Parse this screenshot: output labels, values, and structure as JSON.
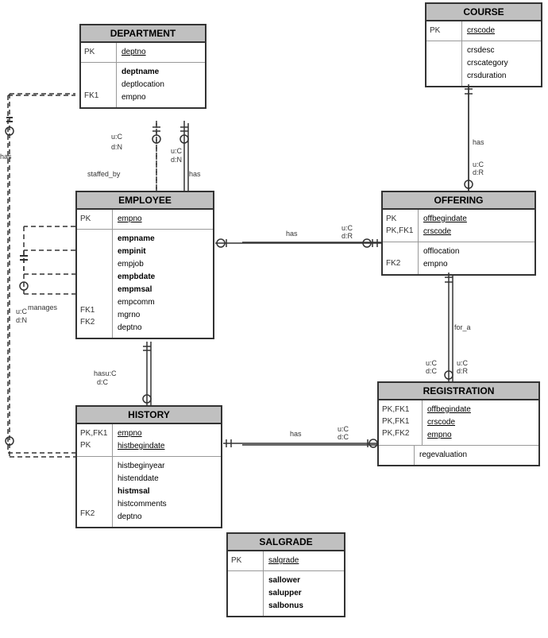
{
  "entities": {
    "department": {
      "title": "DEPARTMENT",
      "pk_rows": [
        {
          "label": "PK",
          "field": "deptno",
          "underline": true,
          "bold": false
        }
      ],
      "attr_rows": [
        {
          "label": "",
          "field": "deptname",
          "bold": true
        },
        {
          "label": "",
          "field": "deptlocation",
          "bold": false
        },
        {
          "label": "FK1",
          "field": "empno",
          "bold": false
        }
      ]
    },
    "employee": {
      "title": "EMPLOYEE",
      "pk_rows": [
        {
          "label": "PK",
          "field": "empno",
          "underline": true,
          "bold": false
        }
      ],
      "attr_rows": [
        {
          "label": "",
          "field": "empname",
          "bold": true
        },
        {
          "label": "",
          "field": "empinit",
          "bold": true
        },
        {
          "label": "",
          "field": "empjob",
          "bold": false
        },
        {
          "label": "",
          "field": "empbdate",
          "bold": true
        },
        {
          "label": "",
          "field": "empmsal",
          "bold": true
        },
        {
          "label": "",
          "field": "empcomm",
          "bold": false
        },
        {
          "label": "FK1",
          "field": "mgrno",
          "bold": false
        },
        {
          "label": "FK2",
          "field": "deptno",
          "bold": false
        }
      ]
    },
    "history": {
      "title": "HISTORY",
      "pk_rows": [
        {
          "label": "PK,FK1",
          "field": "empno",
          "underline": true
        },
        {
          "label": "PK",
          "field": "histbegindate",
          "underline": true
        }
      ],
      "attr_rows": [
        {
          "label": "",
          "field": "histbeginyear",
          "bold": false
        },
        {
          "label": "",
          "field": "histenddate",
          "bold": false
        },
        {
          "label": "",
          "field": "histmsal",
          "bold": true
        },
        {
          "label": "",
          "field": "histcomments",
          "bold": false
        },
        {
          "label": "FK2",
          "field": "deptno",
          "bold": false
        }
      ]
    },
    "course": {
      "title": "COURSE",
      "pk_rows": [
        {
          "label": "PK",
          "field": "crscode",
          "underline": true
        }
      ],
      "attr_rows": [
        {
          "label": "",
          "field": "crsdesc",
          "bold": false
        },
        {
          "label": "",
          "field": "crscategory",
          "bold": false
        },
        {
          "label": "",
          "field": "crsduration",
          "bold": false
        }
      ]
    },
    "offering": {
      "title": "OFFERING",
      "pk_rows": [
        {
          "label": "PK",
          "field": "offbegindate",
          "underline": true
        },
        {
          "label": "PK,FK1",
          "field": "crscode",
          "underline": true
        }
      ],
      "attr_rows": [
        {
          "label": "",
          "field": "offlocation",
          "bold": false
        },
        {
          "label": "FK2",
          "field": "empno",
          "bold": false
        }
      ]
    },
    "registration": {
      "title": "REGISTRATION",
      "pk_rows": [
        {
          "label": "PK,FK1",
          "field": "offbegindate",
          "underline": true
        },
        {
          "label": "PK,FK1",
          "field": "crscode",
          "underline": true
        },
        {
          "label": "PK,FK2",
          "field": "empno",
          "underline": true
        }
      ],
      "attr_rows": [
        {
          "label": "",
          "field": "regevaluation",
          "bold": false
        }
      ]
    },
    "salgrade": {
      "title": "SALGRADE",
      "pk_rows": [
        {
          "label": "PK",
          "field": "salgrade",
          "underline": true
        }
      ],
      "attr_rows": [
        {
          "label": "",
          "field": "sallower",
          "bold": true
        },
        {
          "label": "",
          "field": "salupper",
          "bold": true
        },
        {
          "label": "",
          "field": "salbonus",
          "bold": true
        }
      ]
    }
  },
  "labels": {
    "staffed_by": "staffed_by",
    "has_dept_emp": "has",
    "has_emp_offering": "has",
    "has_emp_history": "has",
    "for_a": "for_a",
    "has_history": "has",
    "manages": "manages",
    "has_left": "has",
    "uC": "u:C",
    "dN": "d:N",
    "uC2": "u:C",
    "dR": "d:R"
  }
}
